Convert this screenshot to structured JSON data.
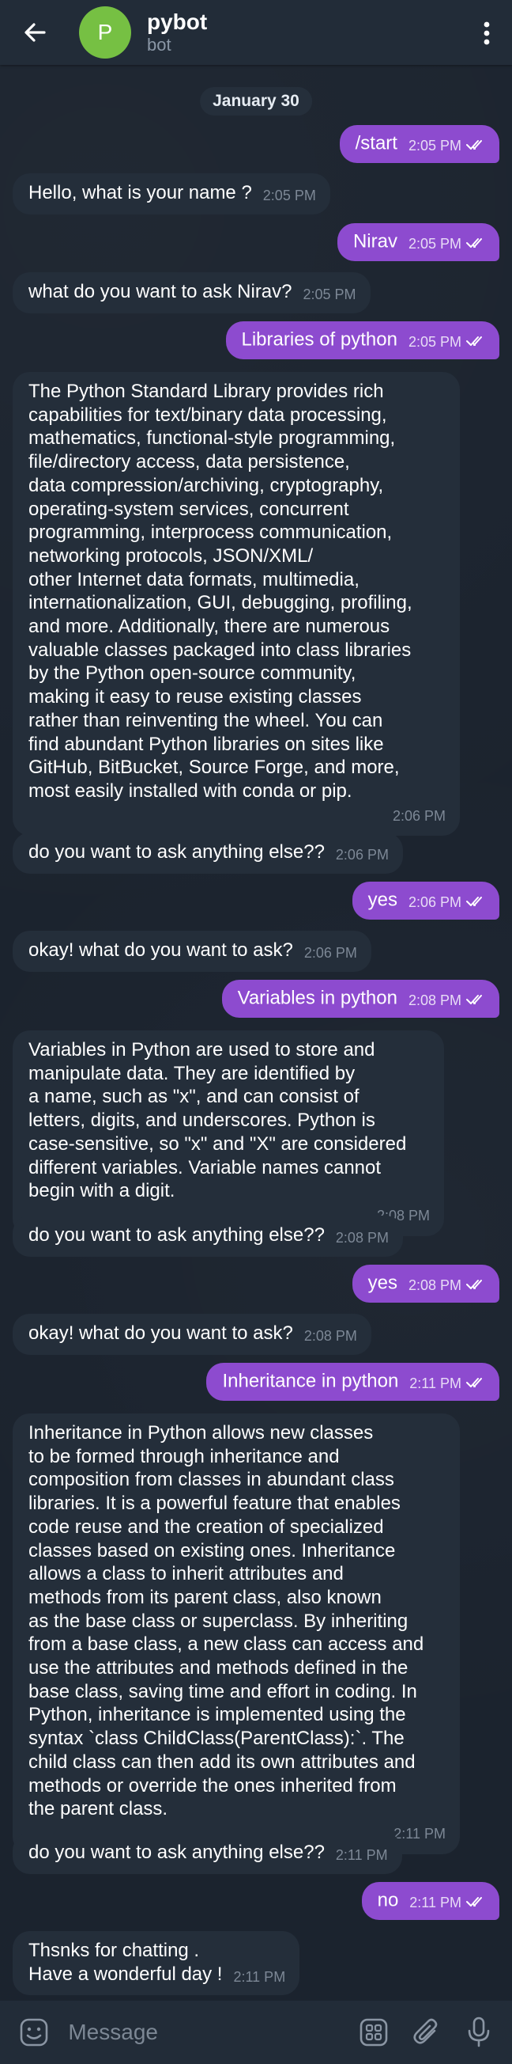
{
  "header": {
    "back_label": "back",
    "avatar_letter": "P",
    "title": "pybot",
    "subtitle": "bot",
    "avatar_color": "#76c043"
  },
  "colors": {
    "outgoing_bubble": "#8d4bcf",
    "incoming_bubble": "#242e3a",
    "background": "#1b232e",
    "header": "#222c38"
  },
  "date_label": "January 30",
  "messages": [
    {
      "dir": "out",
      "text": "/start",
      "time": "2:05 PM",
      "status": "read"
    },
    {
      "dir": "in",
      "text": "Hello, what is your name ?",
      "time": "2:05 PM"
    },
    {
      "dir": "out",
      "text": "Nirav",
      "time": "2:05 PM",
      "status": "read"
    },
    {
      "dir": "in",
      "text": "what do you want to ask Nirav?",
      "time": "2:05 PM"
    },
    {
      "dir": "out",
      "text": "Libraries of python",
      "time": "2:05 PM",
      "status": "read"
    },
    {
      "dir": "in",
      "text": "The Python Standard Library provides rich\ncapabilities for text/binary data processing,\nmathematics, functional-style programming,\nfile/directory access, data persistence,\ndata compression/archiving, cryptography,\noperating-system services, concurrent\nprogramming, interprocess communication,\nnetworking protocols, JSON/XML/\nother Internet data formats, multimedia,\ninternationalization, GUI, debugging, profiling,\nand more. Additionally, there are numerous\nvaluable classes packaged into class libraries\nby the Python open-source community,\nmaking it easy to reuse existing classes\nrather than reinventing the wheel. You can\nfind abundant Python libraries on sites like\nGitHub, BitBucket, Source Forge, and more,\nmost easily installed with conda or pip.",
      "time": "2:06 PM"
    },
    {
      "dir": "in",
      "text": "do you want to ask anything else??",
      "time": "2:06 PM"
    },
    {
      "dir": "out",
      "text": "yes",
      "time": "2:06 PM",
      "status": "read"
    },
    {
      "dir": "in",
      "text": "okay! what do you want to ask?",
      "time": "2:06 PM"
    },
    {
      "dir": "out",
      "text": "Variables in python",
      "time": "2:08 PM",
      "status": "read"
    },
    {
      "dir": "in",
      "text": "Variables in Python are used to store and\nmanipulate data. They are identified by\na name, such as \"x\", and can consist of\nletters, digits, and underscores. Python is\ncase-sensitive, so \"x\" and \"X\" are considered\ndifferent variables. Variable names cannot\nbegin with a digit.",
      "time": "2:08 PM"
    },
    {
      "dir": "in",
      "text": "do you want to ask anything else??",
      "time": "2:08 PM"
    },
    {
      "dir": "out",
      "text": "yes",
      "time": "2:08 PM",
      "status": "read"
    },
    {
      "dir": "in",
      "text": "okay! what do you want to ask?",
      "time": "2:08 PM"
    },
    {
      "dir": "out",
      "text": "Inheritance in python",
      "time": "2:11 PM",
      "status": "read"
    },
    {
      "dir": "in",
      "text": "Inheritance in Python allows new classes\nto be formed through inheritance and\ncomposition from classes in abundant class\nlibraries. It is a powerful feature that enables\ncode reuse and the creation of specialized\nclasses based on existing ones. Inheritance\nallows a class to inherit attributes and\nmethods from its parent class, also known\nas the base class or superclass. By inheriting\nfrom a base class, a new class can access and\nuse the attributes and methods defined in the\nbase class, saving time and effort in coding. In\nPython, inheritance is implemented using the\nsyntax `class ChildClass(ParentClass):`. The\nchild class can then add its own attributes and\nmethods or override the ones inherited from\nthe parent class.",
      "time": "2:11 PM"
    },
    {
      "dir": "in",
      "text": "do you want to ask anything else??",
      "time": "2:11 PM"
    },
    {
      "dir": "out",
      "text": "no",
      "time": "2:11 PM",
      "status": "read"
    },
    {
      "dir": "in",
      "text": "Thsnks for chatting .\nHave a wonderful day !",
      "time": "2:11 PM"
    }
  ],
  "composer": {
    "placeholder": "Message",
    "icons": [
      "emoji-icon",
      "bot-menu-icon",
      "attach-icon",
      "microphone-icon"
    ]
  }
}
